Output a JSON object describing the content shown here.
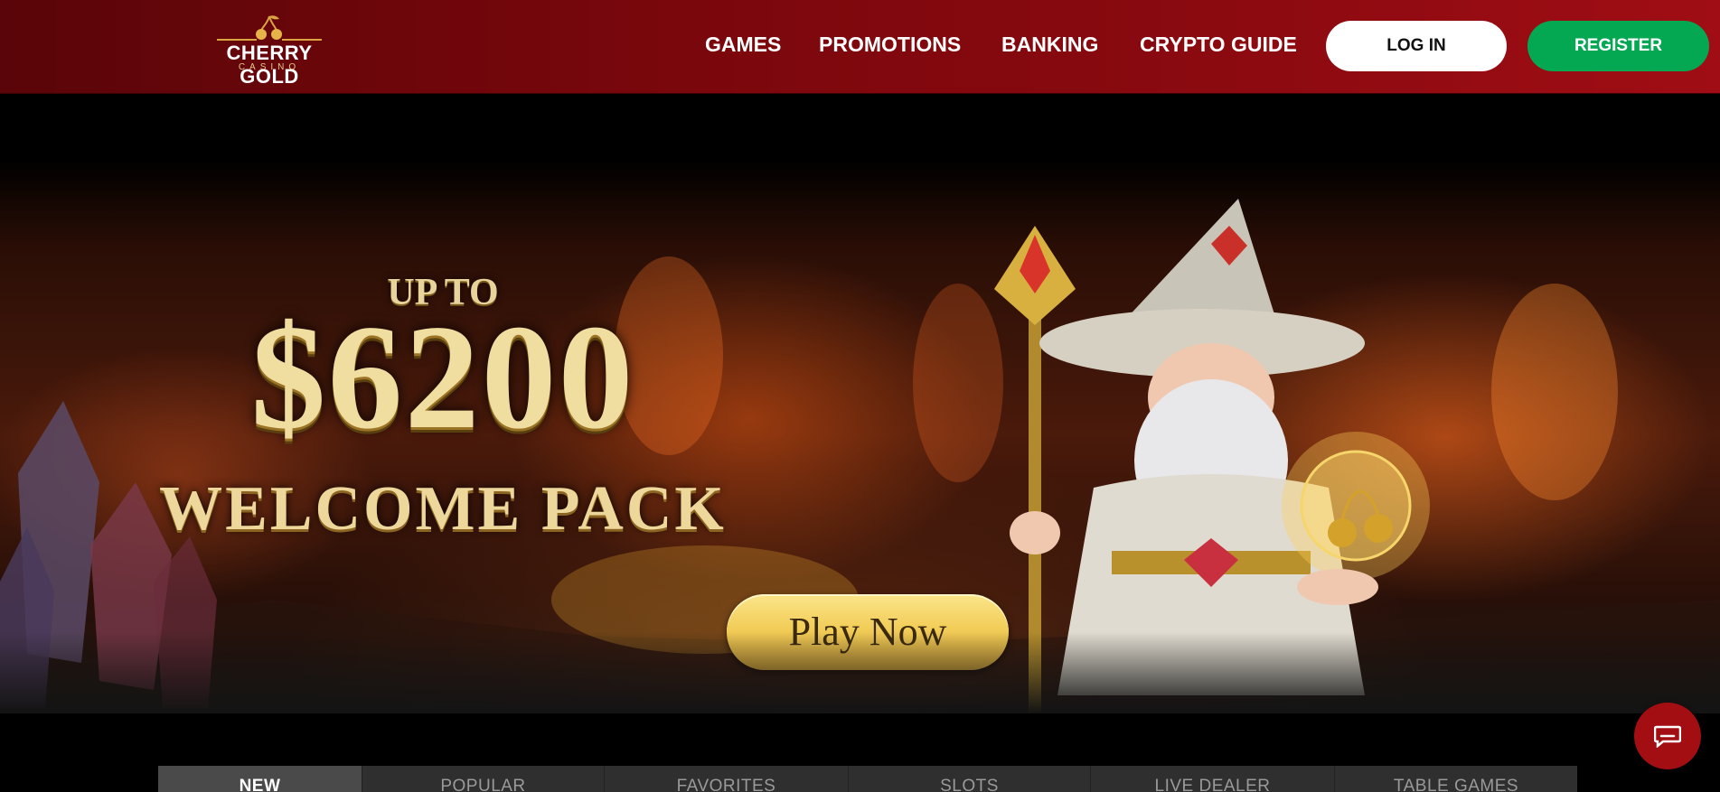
{
  "header": {
    "logo": {
      "name": "CHERRY GOLD",
      "sub": "CASINO"
    },
    "nav": [
      "GAMES",
      "PROMOTIONS",
      "BANKING",
      "CRYPTO GUIDE"
    ],
    "login_label": "LOG IN",
    "register_label": "REGISTER"
  },
  "hero": {
    "up_to": "UP TO",
    "amount": "$6200",
    "pack": "WELCOME PACK",
    "cta": "Play Now"
  },
  "tabs": [
    "NEW",
    "POPULAR",
    "FAVORITES",
    "SLOTS",
    "LIVE DEALER",
    "TABLE GAMES"
  ],
  "active_tab": "NEW",
  "colors": {
    "header_red": "#7a070c",
    "register_green": "#05a852",
    "cta_gold": "#f2cd58",
    "chat_red": "#a30e12"
  },
  "icons": [
    "cherry-logo-icon",
    "chat-icon"
  ]
}
